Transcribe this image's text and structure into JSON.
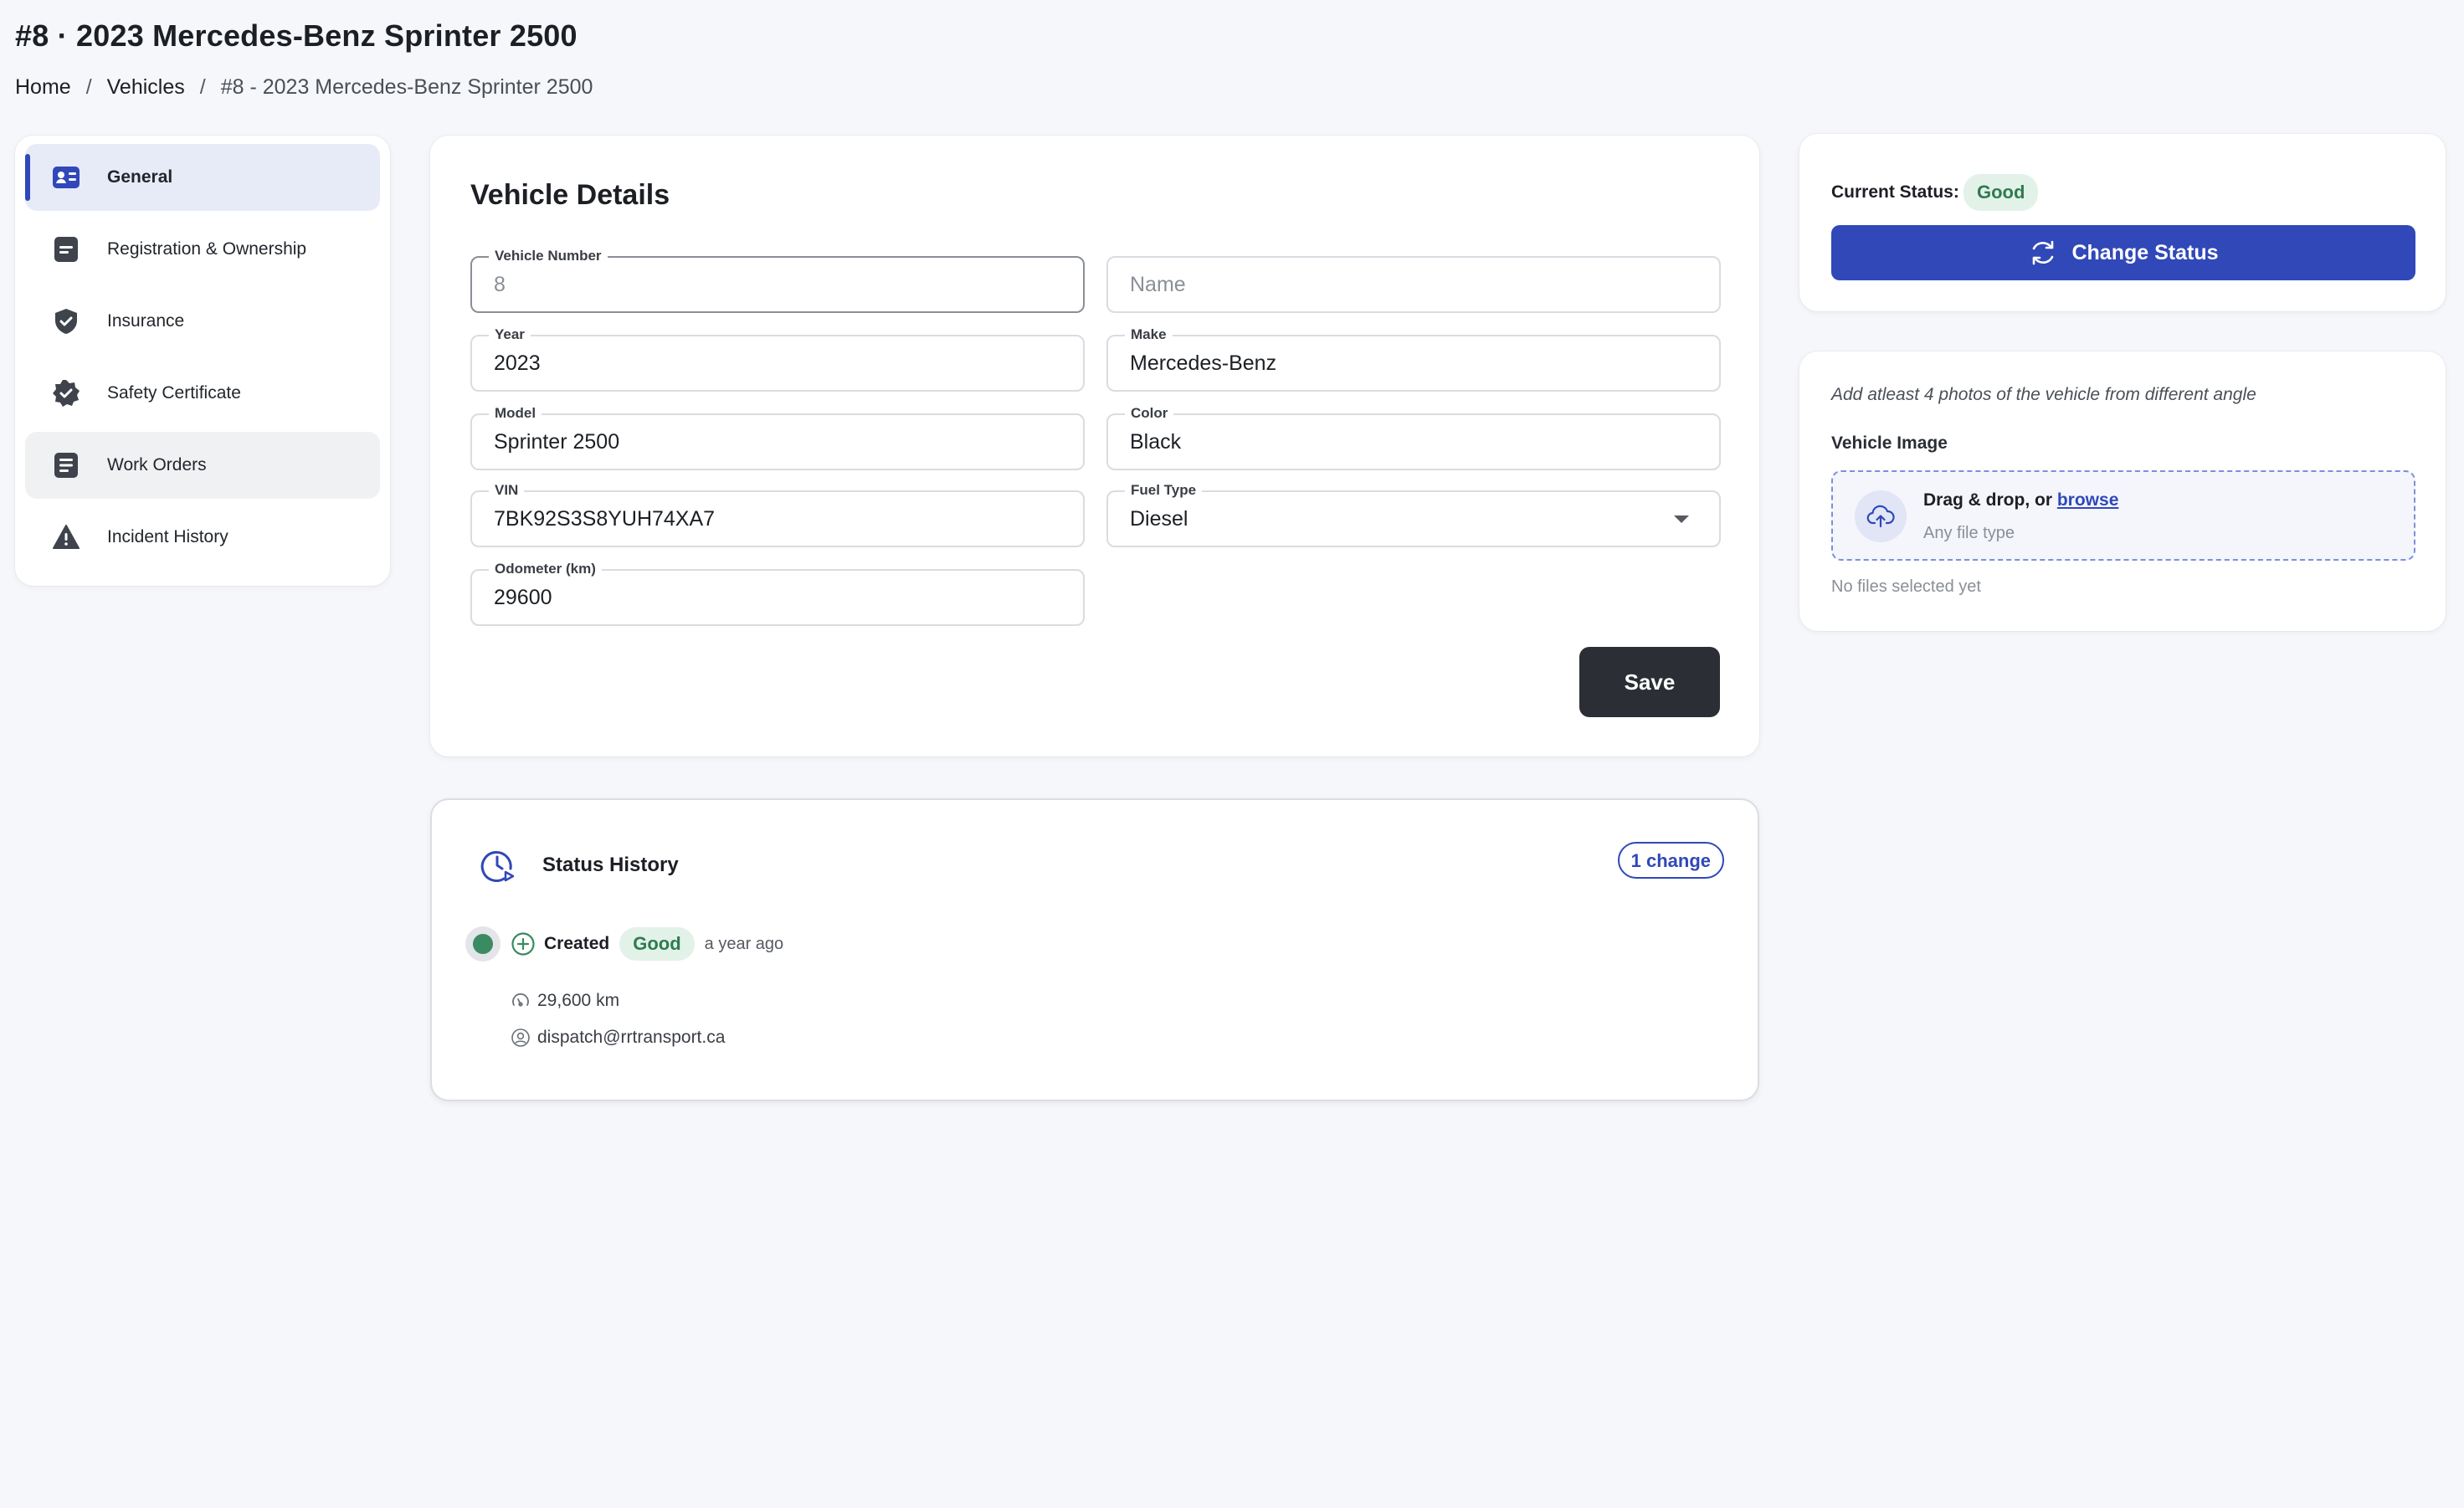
{
  "page": {
    "title": "#8 · 2023 Mercedes-Benz Sprinter 2500",
    "breadcrumb": {
      "home": "Home",
      "vehicles": "Vehicles",
      "current": "#8 - 2023 Mercedes-Benz Sprinter 2500",
      "separator": "/"
    }
  },
  "sidebar": {
    "items": [
      {
        "label": "General",
        "icon": "id-card-icon",
        "state": "active"
      },
      {
        "label": "Registration & Ownership",
        "icon": "document-icon"
      },
      {
        "label": "Insurance",
        "icon": "shield-check-icon"
      },
      {
        "label": "Safety Certificate",
        "icon": "verified-badge-icon"
      },
      {
        "label": "Work Orders",
        "icon": "list-document-icon",
        "state": "hover"
      },
      {
        "label": "Incident History",
        "icon": "warning-icon"
      }
    ]
  },
  "details": {
    "title": "Vehicle Details",
    "fields": {
      "vehicle_number": {
        "label": "Vehicle Number",
        "placeholder": "8"
      },
      "name": {
        "placeholder": "Name"
      },
      "year": {
        "label": "Year",
        "value": "2023"
      },
      "make": {
        "label": "Make",
        "value": "Mercedes-Benz"
      },
      "model": {
        "label": "Model",
        "value": "Sprinter 2500"
      },
      "color": {
        "label": "Color",
        "value": "Black"
      },
      "vin": {
        "label": "VIN",
        "value": "7BK92S3S8YUH74XA7"
      },
      "fuel_type": {
        "label": "Fuel Type",
        "value": "Diesel"
      },
      "odometer": {
        "label": "Odometer (km)",
        "value": "29600"
      }
    },
    "save_label": "Save"
  },
  "history": {
    "title": "Status History",
    "badge": "1 change",
    "entries": [
      {
        "action": "Created",
        "status": "Good",
        "time": "a year ago",
        "odometer": "29,600 km",
        "user": "dispatch@rrtransport.ca"
      }
    ]
  },
  "status": {
    "label": "Current Status:",
    "value": "Good",
    "button": "Change Status"
  },
  "image_upload": {
    "hint": "Add atleast 4 photos of the vehicle from different angle",
    "label": "Vehicle Image",
    "drop_text": "Drag & drop, or",
    "browse": "browse",
    "file_type": "Any file type",
    "no_files": "No files selected yet"
  },
  "colors": {
    "accent": "#3048b8",
    "dark_button": "#2b2f35",
    "good": "#2f7a52",
    "good_bg": "#e2f2e8",
    "background": "#f6f7fb"
  }
}
